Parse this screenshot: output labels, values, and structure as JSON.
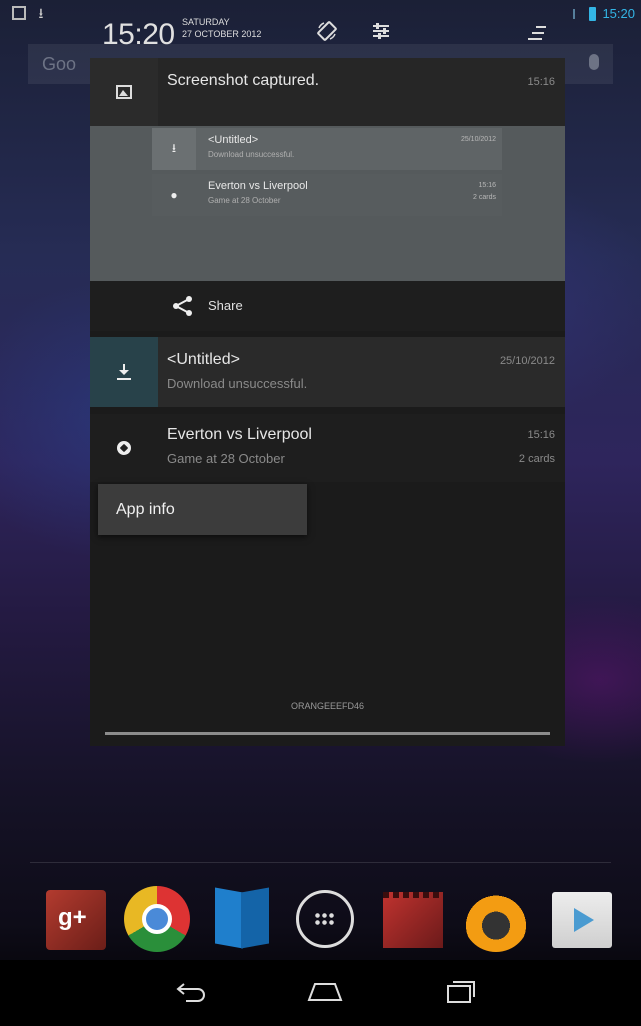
{
  "status_bar": {
    "time": "15:20"
  },
  "homescreen": {
    "search_hint": "Goo"
  },
  "notification_header": {
    "time": "15:20",
    "day": "SATURDAY",
    "date": "27 OCTOBER 2012"
  },
  "notifications": {
    "screenshot": {
      "title": "Screenshot captured.",
      "time": "15:16",
      "preview_items": [
        {
          "title": "<Untitled>",
          "subtitle": "Download unsuccessful.",
          "time": "25/10/2012"
        },
        {
          "title": "Everton vs Liverpool",
          "subtitle": "Game at 28 October",
          "time": "15:16",
          "extra": "2 cards"
        }
      ],
      "share_label": "Share"
    },
    "download": {
      "title": "<Untitled>",
      "subtitle": "Download unsuccessful.",
      "time": "25/10/2012"
    },
    "everton": {
      "title": "Everton vs Liverpool",
      "subtitle": "Game at 28 October",
      "time": "15:16",
      "extra": "2 cards"
    }
  },
  "popup": {
    "label": "App info"
  },
  "carrier": "ORANGEEEFD46",
  "dock": {
    "gplus_label": "g+"
  },
  "colors": {
    "accent": "#33b5e5",
    "download_icon_bg": "#28424a"
  }
}
